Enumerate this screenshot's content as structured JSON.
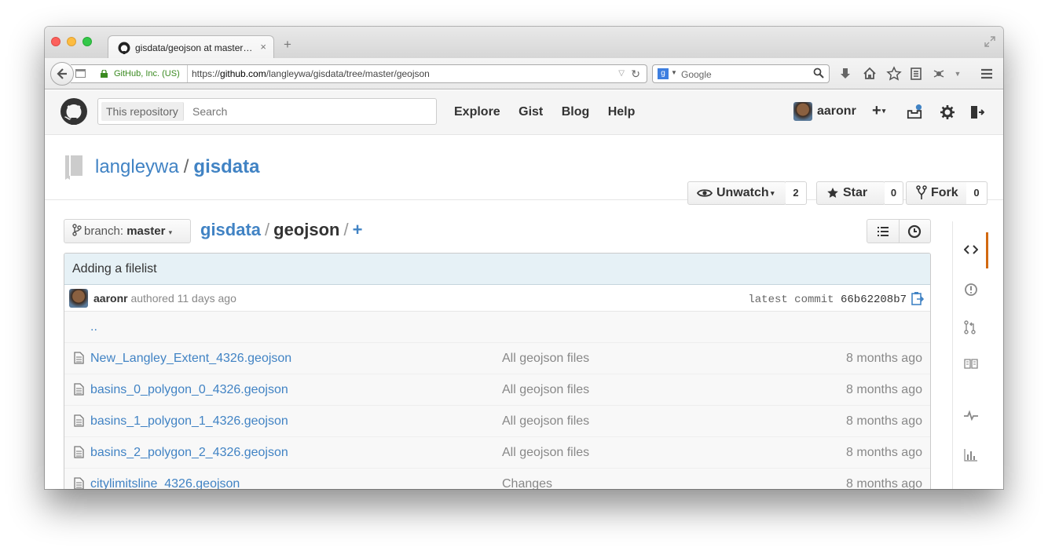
{
  "browser": {
    "tab_title": "gisdata/geojson at master…",
    "tab_close": "×",
    "new_tab": "+",
    "ssl_org": "GitHub, Inc. (US)",
    "url_prefix": "https://",
    "url_host": "github.com",
    "url_path": "/langleywa/gisdata/tree/master/geojson",
    "search_placeholder": "Google",
    "search_engine_glyph": "g"
  },
  "github": {
    "search_scope": "This repository",
    "search_placeholder": "Search",
    "nav": [
      "Explore",
      "Gist",
      "Blog",
      "Help"
    ],
    "username": "aaronr",
    "plus_label": "+"
  },
  "repo": {
    "owner": "langleywa",
    "separator": "/",
    "name": "gisdata",
    "watch_label": "Unwatch",
    "watch_count": "2",
    "star_label": "Star",
    "star_count": "0",
    "fork_label": "Fork",
    "fork_count": "0"
  },
  "file_nav": {
    "branch_prefix": "branch:",
    "branch_name": "master",
    "crumb_repo": "gisdata",
    "crumb_sep": "/",
    "crumb_dir": "geojson",
    "crumb_sep2": "/",
    "crumb_plus": "+"
  },
  "commit": {
    "message": "Adding a filelist",
    "author": "aaronr",
    "authored_text": "authored 11 days ago",
    "latest_label": "latest commit",
    "sha": "66b62208b7"
  },
  "updir": "..",
  "files": [
    {
      "name": "New_Langley_Extent_4326.geojson",
      "message": "All geojson files",
      "age": "8 months ago"
    },
    {
      "name": "basins_0_polygon_0_4326.geojson",
      "message": "All geojson files",
      "age": "8 months ago"
    },
    {
      "name": "basins_1_polygon_1_4326.geojson",
      "message": "All geojson files",
      "age": "8 months ago"
    },
    {
      "name": "basins_2_polygon_2_4326.geojson",
      "message": "All geojson files",
      "age": "8 months ago"
    },
    {
      "name": "citylimitsline_4326.geojson",
      "message": "Changes",
      "age": "8 months ago"
    }
  ],
  "colors": {
    "link": "#4183c4",
    "active_tab_marker": "#d26911",
    "commit_bar": "#e6f1f6"
  }
}
